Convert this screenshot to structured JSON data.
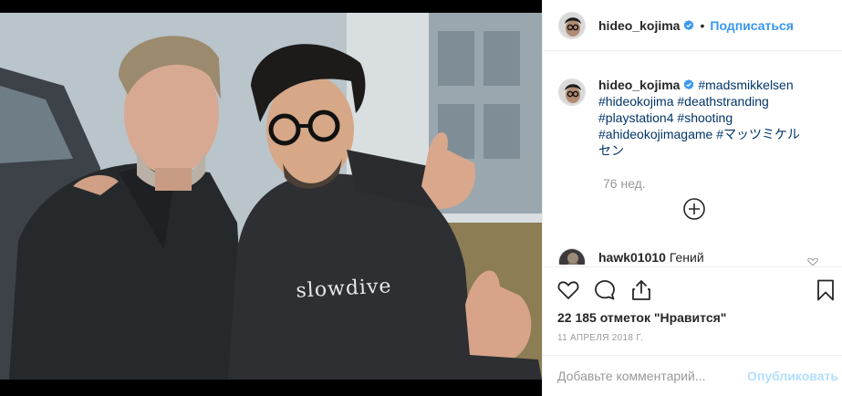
{
  "post": {
    "author": "hideo_kojima",
    "follow_label": "Подписаться",
    "separator": "•",
    "photo_shirt_text": "slowdive"
  },
  "caption": {
    "author": "hideo_kojima",
    "tags": [
      "#madsmikkelsen",
      "#hideokojima",
      "#deathstranding",
      "#playstation4",
      "#shooting",
      "#ahideokojimagame",
      "#マッツミケル",
      "セン"
    ],
    "time_ago": "76 нед."
  },
  "comments": [
    {
      "author": "hawk01010",
      "text": "Гений"
    }
  ],
  "stats": {
    "likes": "22 185 отметок \"Нравится\"",
    "date": "11 АПРЕЛЯ 2018 Г."
  },
  "add_comment": {
    "placeholder": "Добавьте комментарий...",
    "publish_label": "Опубликовать"
  },
  "icons": {
    "verified": "verified-badge-icon",
    "like": "heart-icon",
    "comment": "comment-icon",
    "share": "share-icon",
    "save": "bookmark-icon",
    "more": "plus-circle-icon"
  },
  "colors": {
    "link": "#3897f0",
    "hashtag": "#003569",
    "muted": "#999999",
    "publish_disabled": "#b2dffc",
    "border": "#efefef"
  }
}
